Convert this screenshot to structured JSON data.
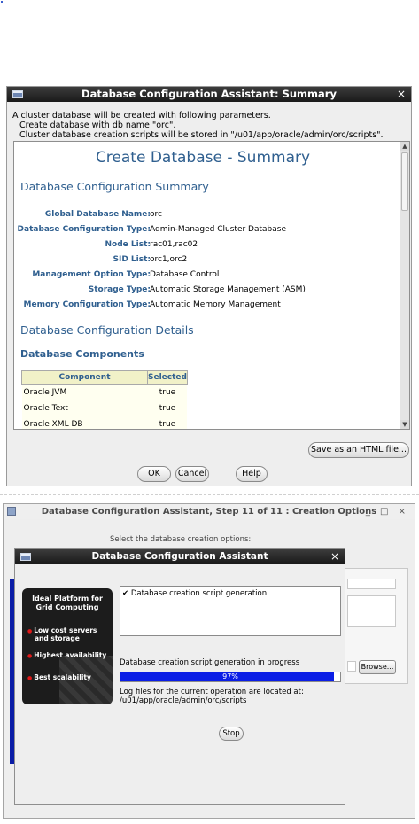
{
  "summary_window": {
    "title": "Database Configuration Assistant: Summary",
    "close_glyph": "×",
    "intro": [
      "A cluster database will be created with following parameters.",
      "Create database with db name \"orc\".",
      "Cluster database creation scripts will be stored in \"/u01/app/oracle/admin/orc/scripts\"."
    ],
    "page_title": "Create Database - Summary",
    "config_summary_heading": "Database Configuration Summary",
    "params": [
      {
        "key": "Global Database Name:",
        "value": "orc"
      },
      {
        "key": "Database Configuration Type:",
        "value": "Admin-Managed Cluster Database"
      },
      {
        "key": "Node List:",
        "value": "rac01,rac02"
      },
      {
        "key": "SID List:",
        "value": "orc1,orc2"
      },
      {
        "key": "Management Option Type:",
        "value": "Database Control"
      },
      {
        "key": "Storage Type:",
        "value": "Automatic Storage Management (ASM)"
      },
      {
        "key": "Memory Configuration Type:",
        "value": "Automatic Memory Management"
      }
    ],
    "config_details_heading": "Database Configuration Details",
    "components_heading": "Database Components",
    "components_table": {
      "headers": [
        "Component",
        "Selected"
      ],
      "rows": [
        [
          "Oracle JVM",
          "true"
        ],
        [
          "Oracle Text",
          "true"
        ],
        [
          "Oracle XML DB",
          "true"
        ]
      ]
    },
    "save_button": "Save as an HTML file...",
    "ok_button": "OK",
    "cancel_button": "Cancel",
    "help_button": "Help"
  },
  "wizard_window": {
    "title": "Database Configuration Assistant, Step 11 of 11 : Creation Options",
    "window_controls": "_ □ ×",
    "instruction": "Select the database creation options:",
    "browse_button": "Browse..."
  },
  "progress_dialog": {
    "title": "Database Configuration Assistant",
    "close_glyph": "×",
    "banner": {
      "headline_1": "Ideal Platform for",
      "headline_2": "Grid Computing",
      "bullets": [
        "Low cost servers",
        "and storage",
        "Highest availability",
        "Best scalability"
      ]
    },
    "log_item": "✔ Database creation script generation",
    "status": "Database creation script generation in progress",
    "progress_percent": 97,
    "progress_label": "97%",
    "log_location_1": "Log files for the current operation are located at:",
    "log_location_2": "/u01/app/oracle/admin/orc/scripts",
    "stop_button": "Stop"
  },
  "colors": {
    "heading_blue": "#2f5f8f",
    "progress_fill": "#0b1ee6",
    "titlebar_dark": "#1a1a1a"
  }
}
